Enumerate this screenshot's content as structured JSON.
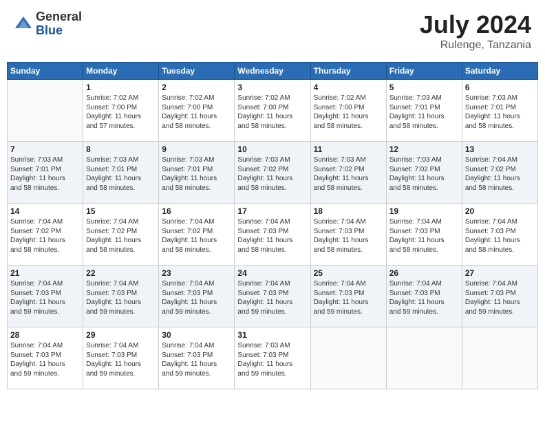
{
  "header": {
    "logo_general": "General",
    "logo_blue": "Blue",
    "month_title": "July 2024",
    "location": "Rulenge, Tanzania"
  },
  "weekdays": [
    "Sunday",
    "Monday",
    "Tuesday",
    "Wednesday",
    "Thursday",
    "Friday",
    "Saturday"
  ],
  "weeks": [
    [
      {
        "day": null
      },
      {
        "day": "1",
        "sunrise": "7:02 AM",
        "sunset": "7:00 PM",
        "daylight": "11 hours and 57 minutes."
      },
      {
        "day": "2",
        "sunrise": "7:02 AM",
        "sunset": "7:00 PM",
        "daylight": "11 hours and 58 minutes."
      },
      {
        "day": "3",
        "sunrise": "7:02 AM",
        "sunset": "7:00 PM",
        "daylight": "11 hours and 58 minutes."
      },
      {
        "day": "4",
        "sunrise": "7:02 AM",
        "sunset": "7:00 PM",
        "daylight": "11 hours and 58 minutes."
      },
      {
        "day": "5",
        "sunrise": "7:03 AM",
        "sunset": "7:01 PM",
        "daylight": "11 hours and 58 minutes."
      },
      {
        "day": "6",
        "sunrise": "7:03 AM",
        "sunset": "7:01 PM",
        "daylight": "11 hours and 58 minutes."
      }
    ],
    [
      {
        "day": "7",
        "sunrise": "7:03 AM",
        "sunset": "7:01 PM",
        "daylight": "11 hours and 58 minutes."
      },
      {
        "day": "8",
        "sunrise": "7:03 AM",
        "sunset": "7:01 PM",
        "daylight": "11 hours and 58 minutes."
      },
      {
        "day": "9",
        "sunrise": "7:03 AM",
        "sunset": "7:01 PM",
        "daylight": "11 hours and 58 minutes."
      },
      {
        "day": "10",
        "sunrise": "7:03 AM",
        "sunset": "7:02 PM",
        "daylight": "11 hours and 58 minutes."
      },
      {
        "day": "11",
        "sunrise": "7:03 AM",
        "sunset": "7:02 PM",
        "daylight": "11 hours and 58 minutes."
      },
      {
        "day": "12",
        "sunrise": "7:03 AM",
        "sunset": "7:02 PM",
        "daylight": "11 hours and 58 minutes."
      },
      {
        "day": "13",
        "sunrise": "7:04 AM",
        "sunset": "7:02 PM",
        "daylight": "11 hours and 58 minutes."
      }
    ],
    [
      {
        "day": "14",
        "sunrise": "7:04 AM",
        "sunset": "7:02 PM",
        "daylight": "11 hours and 58 minutes."
      },
      {
        "day": "15",
        "sunrise": "7:04 AM",
        "sunset": "7:02 PM",
        "daylight": "11 hours and 58 minutes."
      },
      {
        "day": "16",
        "sunrise": "7:04 AM",
        "sunset": "7:02 PM",
        "daylight": "11 hours and 58 minutes."
      },
      {
        "day": "17",
        "sunrise": "7:04 AM",
        "sunset": "7:03 PM",
        "daylight": "11 hours and 58 minutes."
      },
      {
        "day": "18",
        "sunrise": "7:04 AM",
        "sunset": "7:03 PM",
        "daylight": "11 hours and 58 minutes."
      },
      {
        "day": "19",
        "sunrise": "7:04 AM",
        "sunset": "7:03 PM",
        "daylight": "11 hours and 58 minutes."
      },
      {
        "day": "20",
        "sunrise": "7:04 AM",
        "sunset": "7:03 PM",
        "daylight": "11 hours and 58 minutes."
      }
    ],
    [
      {
        "day": "21",
        "sunrise": "7:04 AM",
        "sunset": "7:03 PM",
        "daylight": "11 hours and 59 minutes."
      },
      {
        "day": "22",
        "sunrise": "7:04 AM",
        "sunset": "7:03 PM",
        "daylight": "11 hours and 59 minutes."
      },
      {
        "day": "23",
        "sunrise": "7:04 AM",
        "sunset": "7:03 PM",
        "daylight": "11 hours and 59 minutes."
      },
      {
        "day": "24",
        "sunrise": "7:04 AM",
        "sunset": "7:03 PM",
        "daylight": "11 hours and 59 minutes."
      },
      {
        "day": "25",
        "sunrise": "7:04 AM",
        "sunset": "7:03 PM",
        "daylight": "11 hours and 59 minutes."
      },
      {
        "day": "26",
        "sunrise": "7:04 AM",
        "sunset": "7:03 PM",
        "daylight": "11 hours and 59 minutes."
      },
      {
        "day": "27",
        "sunrise": "7:04 AM",
        "sunset": "7:03 PM",
        "daylight": "11 hours and 59 minutes."
      }
    ],
    [
      {
        "day": "28",
        "sunrise": "7:04 AM",
        "sunset": "7:03 PM",
        "daylight": "11 hours and 59 minutes."
      },
      {
        "day": "29",
        "sunrise": "7:04 AM",
        "sunset": "7:03 PM",
        "daylight": "11 hours and 59 minutes."
      },
      {
        "day": "30",
        "sunrise": "7:04 AM",
        "sunset": "7:03 PM",
        "daylight": "11 hours and 59 minutes."
      },
      {
        "day": "31",
        "sunrise": "7:03 AM",
        "sunset": "7:03 PM",
        "daylight": "11 hours and 59 minutes."
      },
      {
        "day": null
      },
      {
        "day": null
      },
      {
        "day": null
      }
    ]
  ],
  "labels": {
    "sunrise": "Sunrise:",
    "sunset": "Sunset:",
    "daylight": "Daylight:"
  }
}
